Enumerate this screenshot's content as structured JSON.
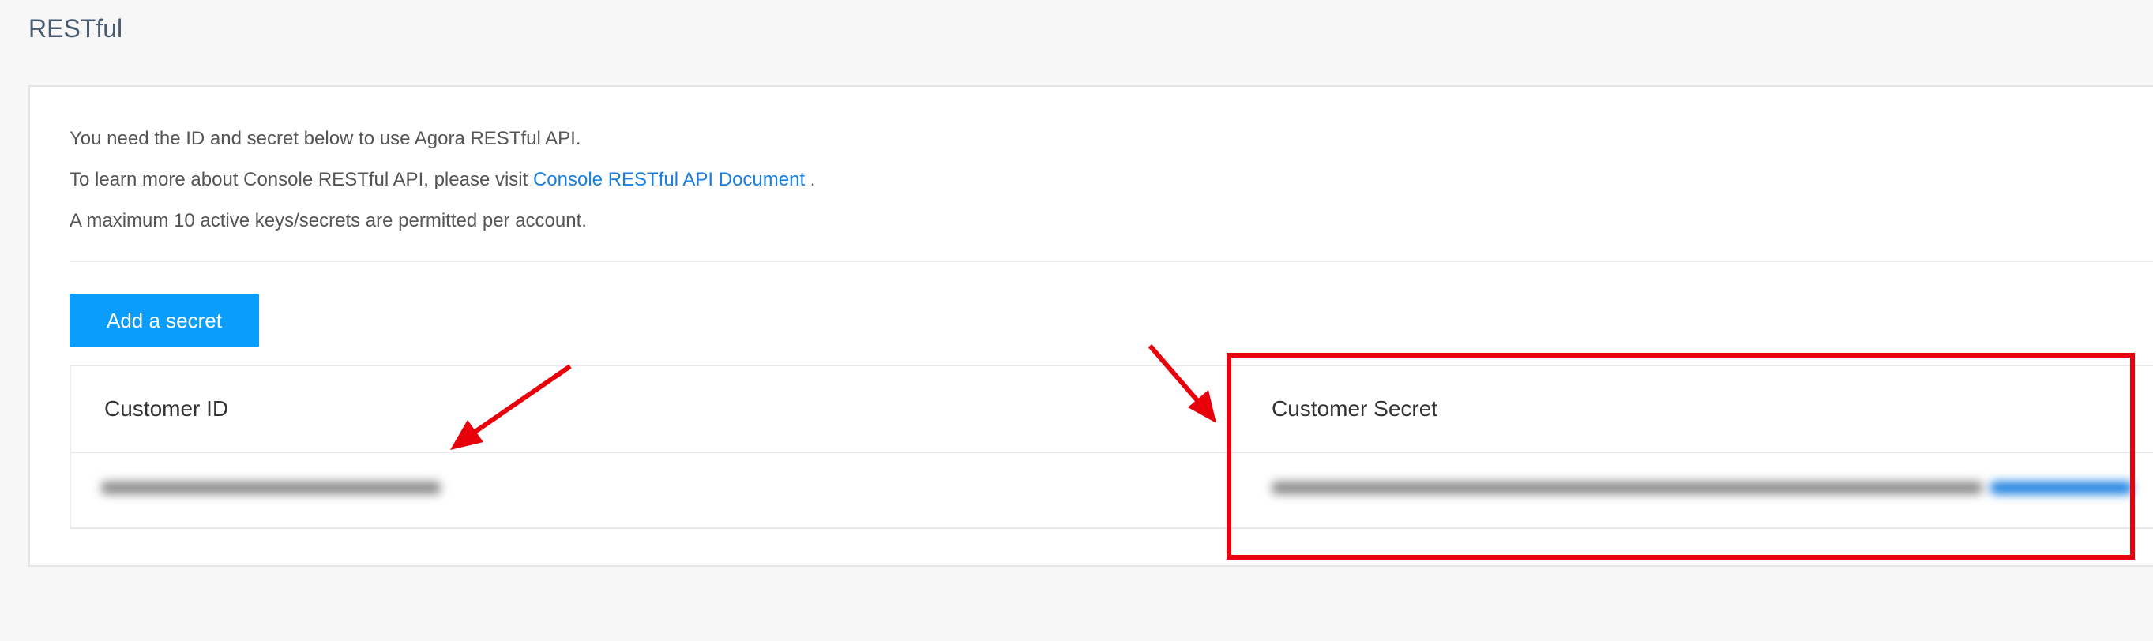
{
  "page": {
    "title": "RESTful"
  },
  "info": {
    "line1": "You need the ID and secret below to use Agora RESTful API.",
    "line2_prefix": "To learn more about Console RESTful API, please visit ",
    "line2_link": "Console RESTful API Document",
    "line2_suffix": " .",
    "line3": "A maximum 10 active keys/secrets are permitted per account."
  },
  "actions": {
    "add_secret_label": "Add a secret"
  },
  "table": {
    "columns": [
      "Customer ID",
      "Customer Secret"
    ],
    "rows": [
      {
        "customer_id": "",
        "customer_secret": ""
      }
    ]
  },
  "annotations": {
    "color": "#e8000b",
    "accent": "#0b9dfb",
    "link_color": "#1a7fe0"
  }
}
